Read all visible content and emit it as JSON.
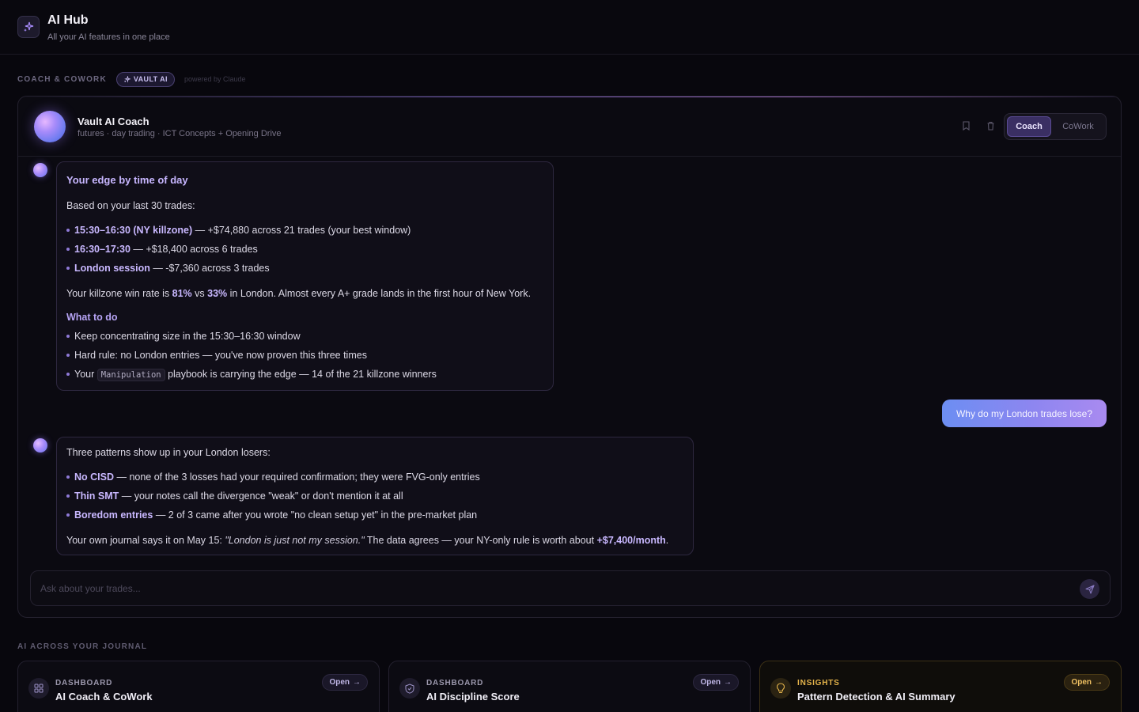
{
  "header": {
    "title": "AI Hub",
    "subtitle": "All your AI features in one place"
  },
  "section": {
    "label": "COACH & COWORK",
    "badge": "VAULT AI",
    "powered": "powered by Claude"
  },
  "coach": {
    "name": "Vault AI Coach",
    "meta": "futures · day trading · ICT Concepts + Opening Drive",
    "modes": [
      "Coach",
      "CoWork"
    ],
    "active_mode": "Coach"
  },
  "messages": {
    "m1": {
      "title": "Your edge by time of day",
      "intro": "Based on your last 30 trades:",
      "b1_hl": "15:30–16:30 (NY killzone)",
      "b1_rest": " — +$74,880 across 21 trades (your best window)",
      "b2_hl": "16:30–17:30",
      "b2_rest": " — +$18,400 across 6 trades",
      "b3_hl": "London session",
      "b3_rest": " — -$7,360 across 3 trades",
      "stat_pre": "Your killzone win rate is ",
      "stat_a": "81%",
      "stat_mid": " vs ",
      "stat_b": "33%",
      "stat_post": " in London. Almost every A+ grade lands in the first hour of New York.",
      "todo_head": "What to do",
      "t1": "Keep concentrating size in the 15:30–16:30 window",
      "t2": "Hard rule: no London entries — you've now proven this three times",
      "t3_pre": "Your ",
      "t3_code": "Manipulation",
      "t3_post": " playbook is carrying the edge — 14 of the 21 killzone winners"
    },
    "user": "Why do my London trades lose?",
    "m2": {
      "intro": "Three patterns show up in your London losers:",
      "b1_hl": "No CISD",
      "b1_rest": " — none of the 3 losses had your required confirmation; they were FVG-only entries",
      "b2_hl": "Thin SMT",
      "b2_rest": " — your notes call the divergence \"weak\" or don't mention it at all",
      "b3_hl": "Boredom entries",
      "b3_rest": " — 2 of 3 came after you wrote \"no clean setup yet\" in the pre-market plan",
      "close_pre": "Your own journal says it on May 15: ",
      "close_quote": "\"London is just not my session.\"",
      "close_mid": " The data agrees — your NY-only rule is worth about ",
      "close_hl": "+$7,400/month",
      "close_post": "."
    }
  },
  "composer": {
    "placeholder": "Ask about your trades..."
  },
  "journal": {
    "label": "AI ACROSS YOUR JOURNAL",
    "cards": [
      {
        "kicker": "DASHBOARD",
        "title": "AI Coach & CoWork",
        "open": "Open",
        "icon": "grid-icon"
      },
      {
        "kicker": "DASHBOARD",
        "title": "AI Discipline Score",
        "open": "Open",
        "icon": "shield-icon"
      },
      {
        "kicker": "INSIGHTS",
        "title": "Pattern Detection & AI Summary",
        "open": "Open",
        "icon": "lightbulb-icon"
      }
    ]
  },
  "colors": {
    "accent": "#a78bfa",
    "amber": "#e5b44b",
    "background": "#08070d"
  }
}
